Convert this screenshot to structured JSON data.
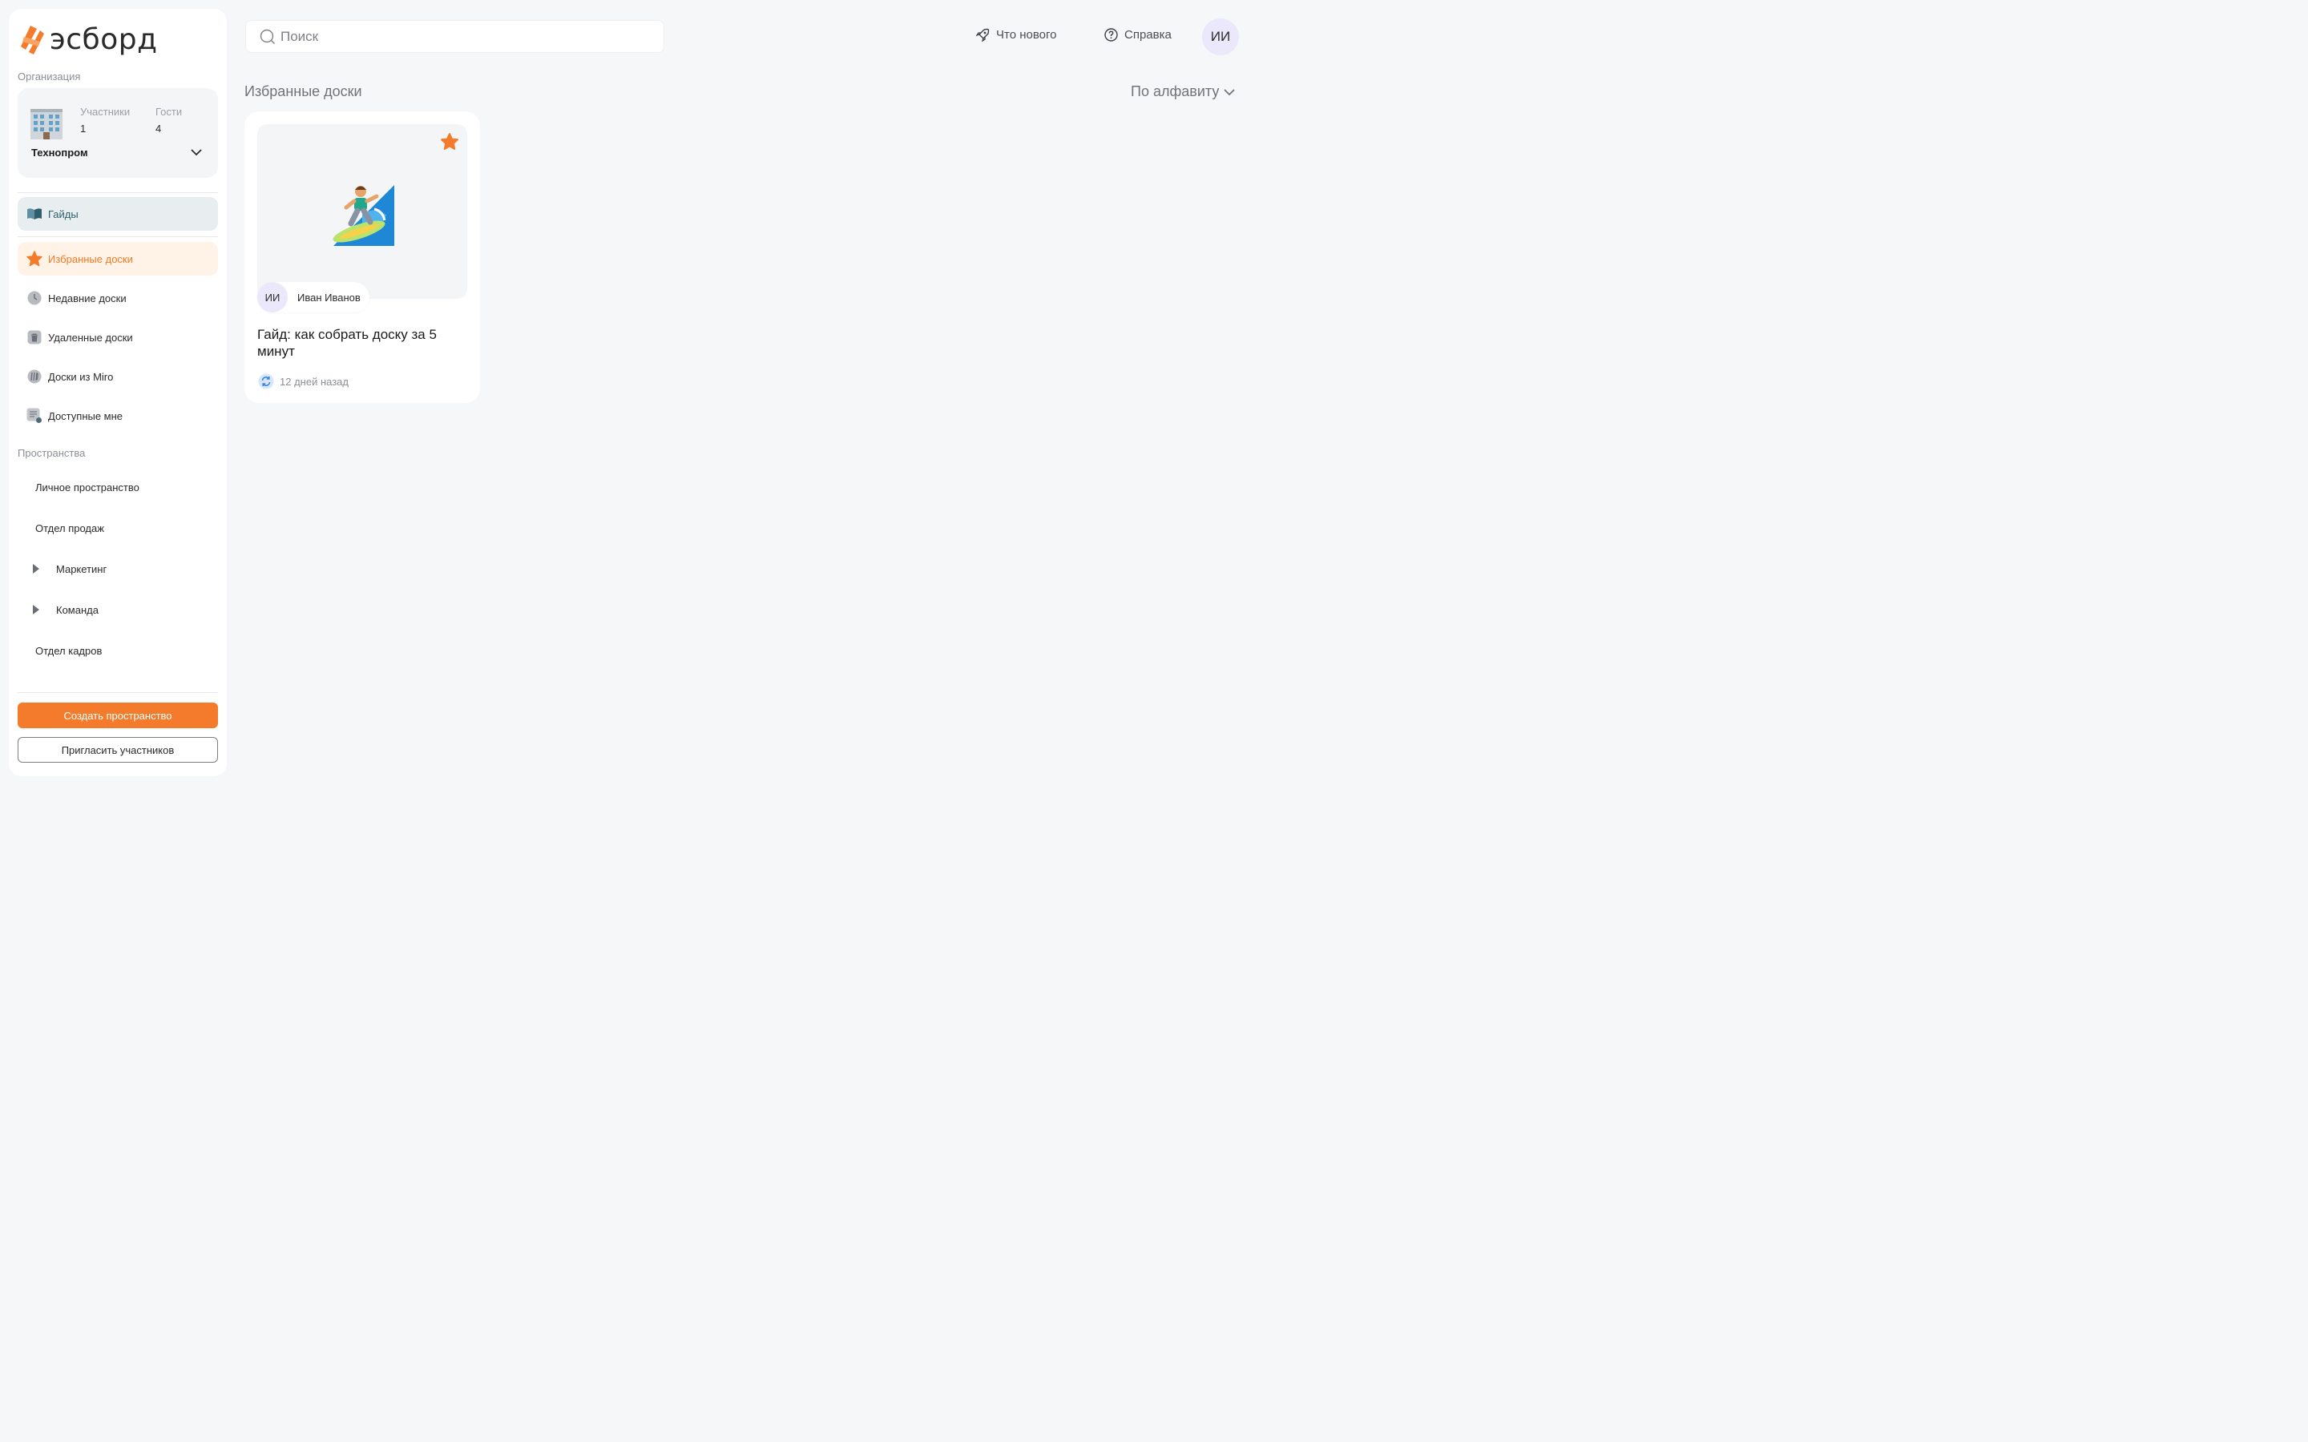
{
  "app": {
    "logo_text": "эсборд",
    "brand_color": "#f47b2c"
  },
  "organization": {
    "section_label": "Организация",
    "name": "Технопром",
    "members_label": "Участники",
    "members_count": "1",
    "guests_label": "Гости",
    "guests_count": "4"
  },
  "nav": {
    "guides": "Гайды",
    "favorites": "Избранные доски",
    "recent": "Недавние доски",
    "deleted": "Удаленные доски",
    "miro": "Доски из Miro",
    "shared": "Доступные мне"
  },
  "spaces": {
    "section_label": "Пространства",
    "items": [
      {
        "label": "Личное пространство",
        "expandable": false
      },
      {
        "label": "Отдел продаж",
        "expandable": false
      },
      {
        "label": "Маркетинг",
        "expandable": true
      },
      {
        "label": "Команда",
        "expandable": true
      },
      {
        "label": "Отдел кадров",
        "expandable": false
      }
    ]
  },
  "buttons": {
    "create_space": "Создать пространство",
    "invite": "Пригласить участников"
  },
  "header": {
    "search_placeholder": "Поиск",
    "whats_new": "Что нового",
    "help": "Справка",
    "avatar_initials": "ИИ"
  },
  "main": {
    "title": "Избранные доски",
    "sort_label": "По алфавиту",
    "boards": [
      {
        "title": "Гайд: как собрать доску за 5 минут",
        "author_initials": "ИИ",
        "author_name": "Иван Иванов",
        "updated": "12 дней назад",
        "favorited": true
      }
    ]
  }
}
